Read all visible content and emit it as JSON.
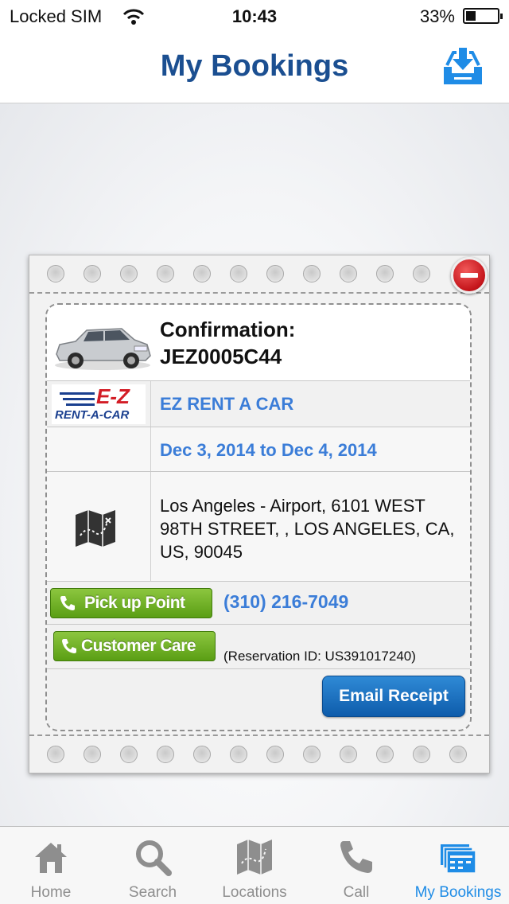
{
  "status_bar": {
    "carrier": "Locked SIM",
    "time": "10:43",
    "battery": "33%"
  },
  "header": {
    "title": "My Bookings",
    "download_icon": "download-tray-icon"
  },
  "booking": {
    "confirmation_label": "Confirmation:",
    "confirmation_code": "JEZ0005C44",
    "company_logo": {
      "top": "E-Z",
      "bottom": "RENT-A-CAR"
    },
    "company_name": "EZ RENT A CAR",
    "dates": "Dec 3, 2014 to Dec 4, 2014",
    "address": "Los Angeles - Airport, 6101 WEST 98TH STREET, , LOS ANGELES, CA, US, 90045",
    "pickup_button": "Pick up Point",
    "pickup_phone": "(310) 216-7049",
    "customer_care_button": "Customer Care",
    "reservation_id": "(Reservation ID: US391017240)",
    "email_button": "Email Receipt"
  },
  "tabs": [
    {
      "label": "Home",
      "icon": "home-icon",
      "active": false
    },
    {
      "label": "Search",
      "icon": "search-icon",
      "active": false
    },
    {
      "label": "Locations",
      "icon": "map-icon",
      "active": false
    },
    {
      "label": "Call",
      "icon": "phone-icon",
      "active": false
    },
    {
      "label": "My Bookings",
      "icon": "bookings-icon",
      "active": true
    }
  ],
  "colors": {
    "title_blue": "#1b4f91",
    "link_blue": "#3b7dd8",
    "active_tab": "#1f8ce6",
    "green_button": "#6aad22",
    "email_button": "#1a6fc2",
    "remove_red": "#c4141a"
  }
}
